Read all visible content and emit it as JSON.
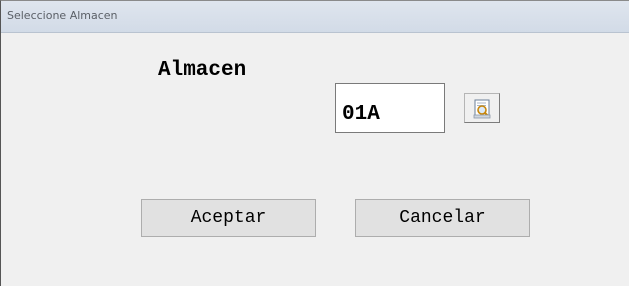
{
  "window": {
    "title": "Seleccione Almacen"
  },
  "form": {
    "almacen_label": "Almacen",
    "almacen_value": "01A",
    "lookup_icon": "search-document-icon"
  },
  "buttons": {
    "accept_label": "Aceptar",
    "cancel_label": "Cancelar"
  },
  "colors": {
    "titlebar": "#d6dfea",
    "dialog_background": "#f0f0f0",
    "button_face": "#e1e1e1"
  }
}
